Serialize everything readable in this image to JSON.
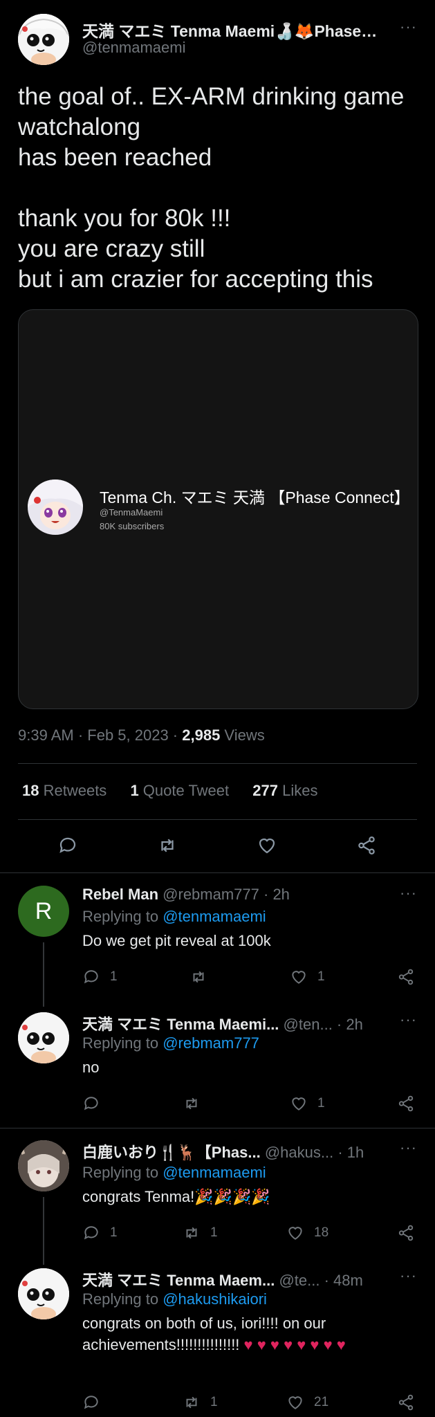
{
  "tweet": {
    "author_name": "天満 マエミ Tenma Maemi🍶🦊Phase…",
    "author_handle": "@tenmamaemi",
    "text": "the goal of.. EX-ARM drinking game\nwatchalong\nhas been reached\n\nthank you for 80k !!!\nyou are crazy still\nbut i am crazier for accepting this",
    "media": {
      "channel_name": "Tenma Ch. マエミ 天満 【Phase Connect】",
      "channel_handle": "@TenmaMaemi",
      "subscribers": "80K subscribers"
    },
    "time": "9:39 AM · Feb 5, 2023 · ",
    "views_count": "2,985",
    "views_label": " Views",
    "retweets_count": "18",
    "retweets_label": " Retweets",
    "quotes_count": "1",
    "quotes_label": " Quote Tweet",
    "likes_count": "277",
    "likes_label": " Likes"
  },
  "replies": [
    {
      "name": "Rebel Man",
      "handle": "@rebmam777",
      "time": " · 2h",
      "replying_label": "Replying to ",
      "replying_to": "@tenmamaemi",
      "text": "Do we get pit reveal at 100k",
      "avatar_letter": "R",
      "replies": "1",
      "retweets": "",
      "likes": "1"
    },
    {
      "name": "天満 マエミ Tenma Maemi...",
      "handle": " @ten...",
      "time": " · 2h",
      "replying_label": "Replying to ",
      "replying_to": "@rebmam777",
      "text": "no",
      "replies": "",
      "retweets": "",
      "likes": "1"
    },
    {
      "name": "白鹿いおり🍴🦌【Phas...",
      "handle": " @hakus...",
      "time": " · 1h",
      "replying_label": "Replying to ",
      "replying_to": "@tenmamaemi",
      "text": "congrats Tenma!🎉🎉🎉🎉",
      "replies": "1",
      "retweets": "1",
      "likes": "18"
    },
    {
      "name": "天満 マエミ Tenma Maem...",
      "handle": " @te...",
      "time": " · 48m",
      "replying_label": "Replying to ",
      "replying_to": "@hakushikaiori",
      "text_main": "congrats on both of us, iori!!!! on our achievements!!!!!!!!!!!!!!! ",
      "text_hearts": "♥ ♥ ♥ ♥ ♥ ♥ ♥ ♥",
      "replies": "",
      "retweets": "1",
      "likes": "21"
    }
  ],
  "colors": {
    "background": "#000000",
    "text": "#e7e9ea",
    "muted": "#71767b",
    "link": "#1d9bf0",
    "heart": "#e0245e",
    "avatar_green": "#2d6a1f"
  }
}
